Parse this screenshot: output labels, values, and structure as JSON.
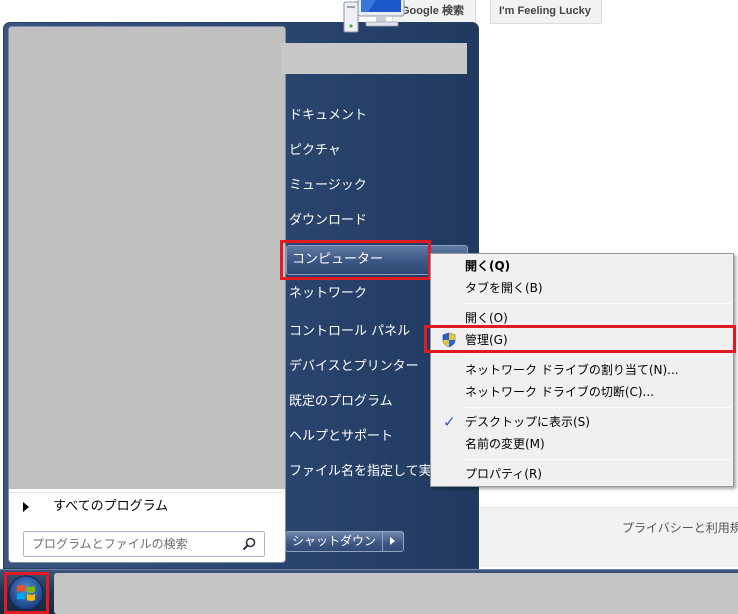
{
  "background": {
    "google_search_button": "Google 検索",
    "lucky_button": "I'm Feeling Lucky",
    "footer_text": "プライバシーと利用規"
  },
  "start_menu": {
    "all_programs": "すべてのプログラム",
    "search_placeholder": "プログラムとファイルの検索",
    "right_items": [
      "ドキュメント",
      "ピクチャ",
      "ミュージック",
      "ダウンロード",
      "コンピューター",
      "ネットワーク",
      "コントロール パネル",
      "デバイスとプリンター",
      "既定のプログラム",
      "ヘルプとサポート",
      "ファイル名を指定して実行..."
    ],
    "shutdown_label": "シャットダウン"
  },
  "context_menu": {
    "items": [
      "開く(Q)",
      "タブを開く(B)",
      "開く(O)",
      "管理(G)",
      "ネットワーク ドライブの割り当て(N)...",
      "ネットワーク ドライブの切断(C)...",
      "デスクトップに表示(S)",
      "名前の変更(M)",
      "プロパティ(R)"
    ]
  },
  "colors": {
    "highlight_border": "#e11b22",
    "menu_blue": "#2b4670",
    "taskbar": "#22334f"
  },
  "icons": [
    "computer-icon",
    "shield-icon",
    "checkmark-icon",
    "search-icon",
    "windows-logo-icon",
    "arrow-right-icon"
  ]
}
